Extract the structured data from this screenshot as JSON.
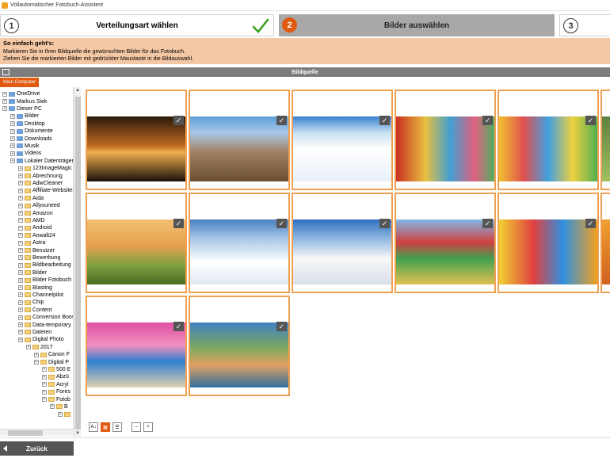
{
  "window": {
    "title": "Vollautomatischer Fotobuch-Assistent"
  },
  "steps": [
    {
      "num": "1",
      "label": "Verteilungsart wählen"
    },
    {
      "num": "2",
      "label": "Bilder auswählen"
    },
    {
      "num": "3",
      "label": ""
    }
  ],
  "hint": {
    "heading": "So einfach geht's:",
    "line1": "Markieren Sie in Ihrer Bildquelle die gewünschten Bilder für das Fotobuch.",
    "line2": "Ziehen Sie die markierten Bilder mit gedrückter Maustaste in die Bildauswahl."
  },
  "source": {
    "title": "Bildquelle",
    "my_computer": "Mein Computer"
  },
  "tree": [
    {
      "label": "OneDrive",
      "indent": 0,
      "type": "drive"
    },
    {
      "label": "Markus Siek",
      "indent": 0,
      "type": "drive"
    },
    {
      "label": "Dieser PC",
      "indent": 0,
      "type": "drive"
    },
    {
      "label": "Bilder",
      "indent": 1,
      "type": "drive"
    },
    {
      "label": "Desktop",
      "indent": 1,
      "type": "drive"
    },
    {
      "label": "Dokumente",
      "indent": 1,
      "type": "drive"
    },
    {
      "label": "Downloads",
      "indent": 1,
      "type": "drive"
    },
    {
      "label": "Musik",
      "indent": 1,
      "type": "drive"
    },
    {
      "label": "Videos",
      "indent": 1,
      "type": "drive"
    },
    {
      "label": "Lokaler Datenträger",
      "indent": 1,
      "type": "drive"
    },
    {
      "label": "123ImageMagic",
      "indent": 2,
      "type": "folder"
    },
    {
      "label": "Abrechnung",
      "indent": 2,
      "type": "folder"
    },
    {
      "label": "AdwCleaner",
      "indent": 2,
      "type": "folder"
    },
    {
      "label": "Affiliate-Websites",
      "indent": 2,
      "type": "folder"
    },
    {
      "label": "Aida",
      "indent": 2,
      "type": "folder"
    },
    {
      "label": "Allyouneed",
      "indent": 2,
      "type": "folder"
    },
    {
      "label": "Amazon",
      "indent": 2,
      "type": "folder"
    },
    {
      "label": "AMD",
      "indent": 2,
      "type": "folder"
    },
    {
      "label": "Android",
      "indent": 2,
      "type": "folder"
    },
    {
      "label": "Anwalt24",
      "indent": 2,
      "type": "folder"
    },
    {
      "label": "Astra",
      "indent": 2,
      "type": "folder"
    },
    {
      "label": "Benutzer",
      "indent": 2,
      "type": "folder"
    },
    {
      "label": "Bewerbung",
      "indent": 2,
      "type": "folder"
    },
    {
      "label": "Bildbearbeitung",
      "indent": 2,
      "type": "folder"
    },
    {
      "label": "Bilder",
      "indent": 2,
      "type": "folder"
    },
    {
      "label": "Bilder Fotobuch",
      "indent": 2,
      "type": "folder"
    },
    {
      "label": "Blasting",
      "indent": 2,
      "type": "folder"
    },
    {
      "label": "Channelpilot",
      "indent": 2,
      "type": "folder"
    },
    {
      "label": "Chip",
      "indent": 2,
      "type": "folder"
    },
    {
      "label": "Content",
      "indent": 2,
      "type": "folder"
    },
    {
      "label": "Conversion Boost",
      "indent": 2,
      "type": "folder"
    },
    {
      "label": "Data-temporary",
      "indent": 2,
      "type": "folder"
    },
    {
      "label": "Dateien",
      "indent": 2,
      "type": "folder"
    },
    {
      "label": "Digital Photo",
      "indent": 2,
      "type": "folder"
    },
    {
      "label": "2017",
      "indent": 3,
      "type": "folder"
    },
    {
      "label": "Canon F",
      "indent": 4,
      "type": "folder"
    },
    {
      "label": "Digital P",
      "indent": 4,
      "type": "folder"
    },
    {
      "label": "500 E",
      "indent": 5,
      "type": "folder"
    },
    {
      "label": "Abzü",
      "indent": 5,
      "type": "folder"
    },
    {
      "label": "Acryl",
      "indent": 5,
      "type": "folder"
    },
    {
      "label": "Fores",
      "indent": 5,
      "type": "folder"
    },
    {
      "label": "Fotob",
      "indent": 5,
      "type": "folder"
    },
    {
      "label": "B",
      "indent": 6,
      "type": "folder"
    },
    {
      "label": "",
      "indent": 7,
      "type": "folder"
    }
  ],
  "photos": [
    {
      "name": "photo-palms-sunset",
      "bg": "linear-gradient(180deg,#2a1a0a 0%,#c06a20 45%,#f0b050 55%,#1a1008 100%)"
    },
    {
      "name": "photo-mountains",
      "bg": "linear-gradient(180deg,#5fa0d8 0%,#a8c8e8 25%,#a08060 55%,#6a5030 100%)"
    },
    {
      "name": "photo-sledding-girl",
      "bg": "linear-gradient(180deg,#3a80d0 0%,#c8e0f0 25%,#ffffff 50%,#e8f0f8 100%)"
    },
    {
      "name": "photo-venice-canal",
      "bg": "linear-gradient(90deg,#c83020 0%,#e8c040 30%,#40a0d0 55%,#e06080 80%,#50b060 100%)"
    },
    {
      "name": "photo-burano-houses",
      "bg": "linear-gradient(90deg,#f0c030 0%,#e05050 25%,#40a0e0 50%,#f0d040 75%,#50b050 100%)"
    },
    {
      "name": "photo-partial-1",
      "bg": "linear-gradient(180deg,#608040 0%,#a0c060 100%)"
    },
    {
      "name": "photo-lighthouse",
      "bg": "linear-gradient(180deg,#f0c070 0%,#e8a050 40%,#80a040 70%,#4a6a20 100%)"
    },
    {
      "name": "photo-family-sled",
      "bg": "linear-gradient(180deg,#4a80c0 0%,#a8c8e8 30%,#ffffff 65%,#e0e8f0 100%)"
    },
    {
      "name": "photo-kids-snow",
      "bg": "linear-gradient(180deg,#3070c0 0%,#90b8e0 30%,#f8f8f8 60%,#d8e0e8 100%)"
    },
    {
      "name": "photo-red-house",
      "bg": "linear-gradient(180deg,#80b8e8 0%,#d04040 35%,#40a050 60%,#e0c050 100%)"
    },
    {
      "name": "photo-colorful-houses",
      "bg": "linear-gradient(90deg,#f0d030 0%,#e04040 35%,#3090e0 65%,#f0a020 100%)"
    },
    {
      "name": "photo-partial-2",
      "bg": "linear-gradient(180deg,#f0a030 0%,#d06020 100%)"
    },
    {
      "name": "photo-flower-alley",
      "bg": "linear-gradient(180deg,#e050a0 0%,#f090c0 35%,#3080d0 60%,#e0d0b0 100%)"
    },
    {
      "name": "photo-harbor-town",
      "bg": "linear-gradient(180deg,#4080c0 0%,#80a860 40%,#e0a060 65%,#3070a0 100%)"
    }
  ],
  "toolbar": {
    "sort_icon": "sort-az-icon",
    "grid_icon": "grid-view-icon",
    "list_icon": "list-view-icon",
    "zoom_out_icon": "zoom-out-icon",
    "zoom_in_icon": "zoom-in-icon"
  },
  "footer": {
    "back_label": "Zurück"
  },
  "colors": {
    "accent": "#e05a10",
    "tile_border": "#f0a050",
    "hint_bg": "#f5c8a5",
    "check_green": "#3aa020"
  }
}
